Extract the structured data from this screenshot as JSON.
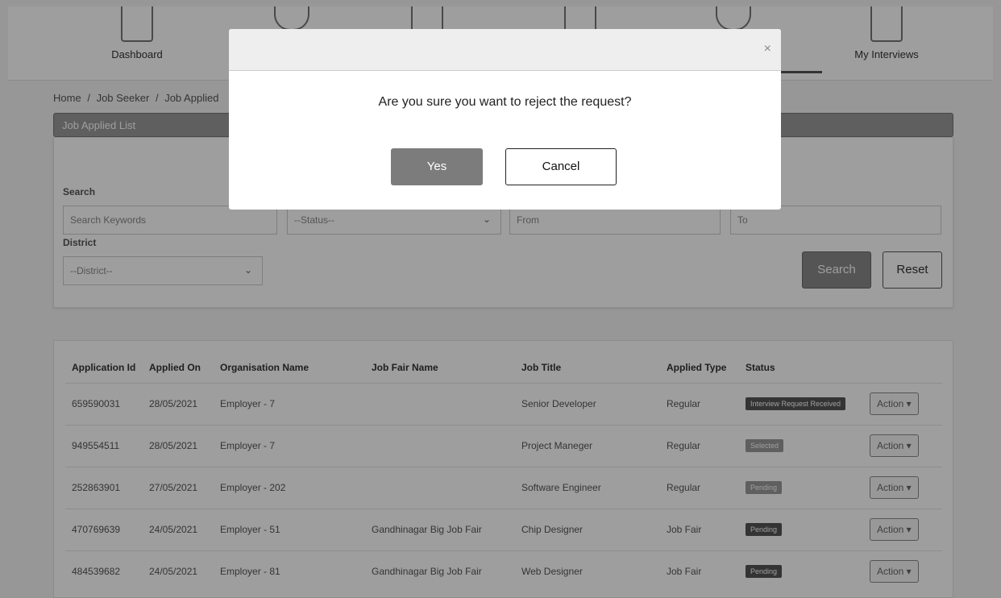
{
  "nav": {
    "items": [
      {
        "label": "Dashboard"
      },
      {
        "label": ""
      },
      {
        "label": ""
      },
      {
        "label": ""
      },
      {
        "label": ""
      },
      {
        "label": "My Interviews"
      }
    ]
  },
  "breadcrumb": [
    "Home",
    "/",
    "Job Seeker",
    "/",
    "Job Applied"
  ],
  "panel_title": "Job Applied List",
  "filters": {
    "search_label": "Search",
    "search_placeholder": "Search Keywords",
    "status_value": "--Status--",
    "from_placeholder": "From",
    "to_placeholder": "To",
    "district_label": "District",
    "district_value": "--District--",
    "search_button": "Search",
    "reset_button": "Reset"
  },
  "table": {
    "headers": [
      "Application Id",
      "Applied On",
      "Organisation Name",
      "Job Fair Name",
      "Job Title",
      "Applied Type",
      "Status",
      ""
    ],
    "rows": [
      {
        "id": "659590031",
        "date": "28/05/2021",
        "org": "Employer - 7",
        "fair": "",
        "title": "Senior Developer",
        "type": "Regular",
        "status": "Interview Request Received"
      },
      {
        "id": "949554511",
        "date": "28/05/2021",
        "org": "Employer - 7",
        "fair": "",
        "title": "Project Maneger",
        "type": "Regular",
        "status": "Selected"
      },
      {
        "id": "252863901",
        "date": "27/05/2021",
        "org": "Employer - 202",
        "fair": "",
        "title": "Software Engineer",
        "type": "Regular",
        "status": "Pending"
      },
      {
        "id": "470769639",
        "date": "24/05/2021",
        "org": "Employer - 51",
        "fair": "Gandhinagar Big Job Fair",
        "title": "Chip Designer",
        "type": "Job Fair",
        "status": "Pending"
      },
      {
        "id": "484539682",
        "date": "24/05/2021",
        "org": "Employer - 81",
        "fair": "Gandhinagar Big Job Fair",
        "title": "Web Designer",
        "type": "Job Fair",
        "status": "Pending"
      }
    ],
    "action_label": "Action ▾"
  },
  "modal": {
    "close": "×",
    "message": "Are you sure you want to reject the request?",
    "yes": "Yes",
    "cancel": "Cancel"
  }
}
